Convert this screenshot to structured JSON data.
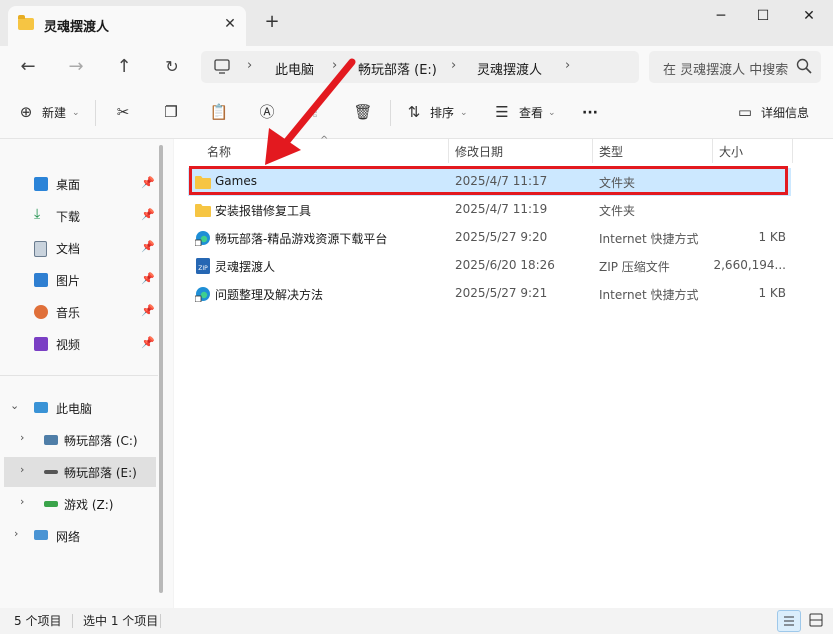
{
  "window": {
    "tab_title": "灵魂摆渡人",
    "close_tab": "✕",
    "new_tab": "+",
    "minimize": "─",
    "maximize": "☐",
    "close": "✕"
  },
  "nav": {
    "back": "←",
    "forward": "→",
    "up": "↑",
    "refresh": "↻"
  },
  "breadcrumb": {
    "root_icon": "computer-icon",
    "items": [
      "此电脑",
      "畅玩部落 (E:)",
      "灵魂摆渡人"
    ],
    "separator": "›"
  },
  "search": {
    "placeholder": "在 灵魂摆渡人 中搜索"
  },
  "toolbar": {
    "new_label": "新建",
    "sort_label": "排序",
    "view_label": "查看",
    "more_label": "···",
    "details_label": "详细信息"
  },
  "sidebar": {
    "quick_access": [
      {
        "label": "桌面",
        "icon": "desktop-icon",
        "color": "#2b84d8"
      },
      {
        "label": "下载",
        "icon": "download-icon",
        "color": "#1b8f4a"
      },
      {
        "label": "文档",
        "icon": "document-icon",
        "color": "#6a7c8f"
      },
      {
        "label": "图片",
        "icon": "pictures-icon",
        "color": "#2f7fd1"
      },
      {
        "label": "音乐",
        "icon": "music-icon",
        "color": "#e0703a"
      },
      {
        "label": "视频",
        "icon": "video-icon",
        "color": "#7a3fc4"
      }
    ],
    "this_pc": "此电脑",
    "drives": [
      {
        "label": "畅玩部落 (C:)",
        "icon": "windows-drive-icon"
      },
      {
        "label": "畅玩部落 (E:)",
        "icon": "drive-icon"
      },
      {
        "label": "游戏 (Z:)",
        "icon": "drive-icon"
      }
    ],
    "network": "网络"
  },
  "columns": {
    "name": "名称",
    "modified": "修改日期",
    "type": "类型",
    "size": "大小"
  },
  "files": [
    {
      "name": "Games",
      "modified": "2025/4/7 11:17",
      "type": "文件夹",
      "size": "",
      "icon": "folder-icon"
    },
    {
      "name": "安装报错修复工具",
      "modified": "2025/4/7 11:19",
      "type": "文件夹",
      "size": "",
      "icon": "folder-icon"
    },
    {
      "name": "畅玩部落-精品游戏资源下载平台",
      "modified": "2025/5/27 9:20",
      "type": "Internet 快捷方式",
      "size": "1 KB",
      "icon": "edge-shortcut-icon"
    },
    {
      "name": "灵魂摆渡人",
      "modified": "2025/6/20 18:26",
      "type": "ZIP 压缩文件",
      "size": "2,660,194...",
      "icon": "zip-icon"
    },
    {
      "name": "问题整理及解决方法",
      "modified": "2025/5/27 9:21",
      "type": "Internet 快捷方式",
      "size": "1 KB",
      "icon": "edge-shortcut-icon"
    }
  ],
  "status": {
    "item_count": "5 个项目",
    "selected": "选中 1 个项目"
  },
  "colors": {
    "selection": "#cce8ff",
    "highlight_box": "#e3191f",
    "arrow": "#e3191f",
    "folder": "#f6c543"
  }
}
